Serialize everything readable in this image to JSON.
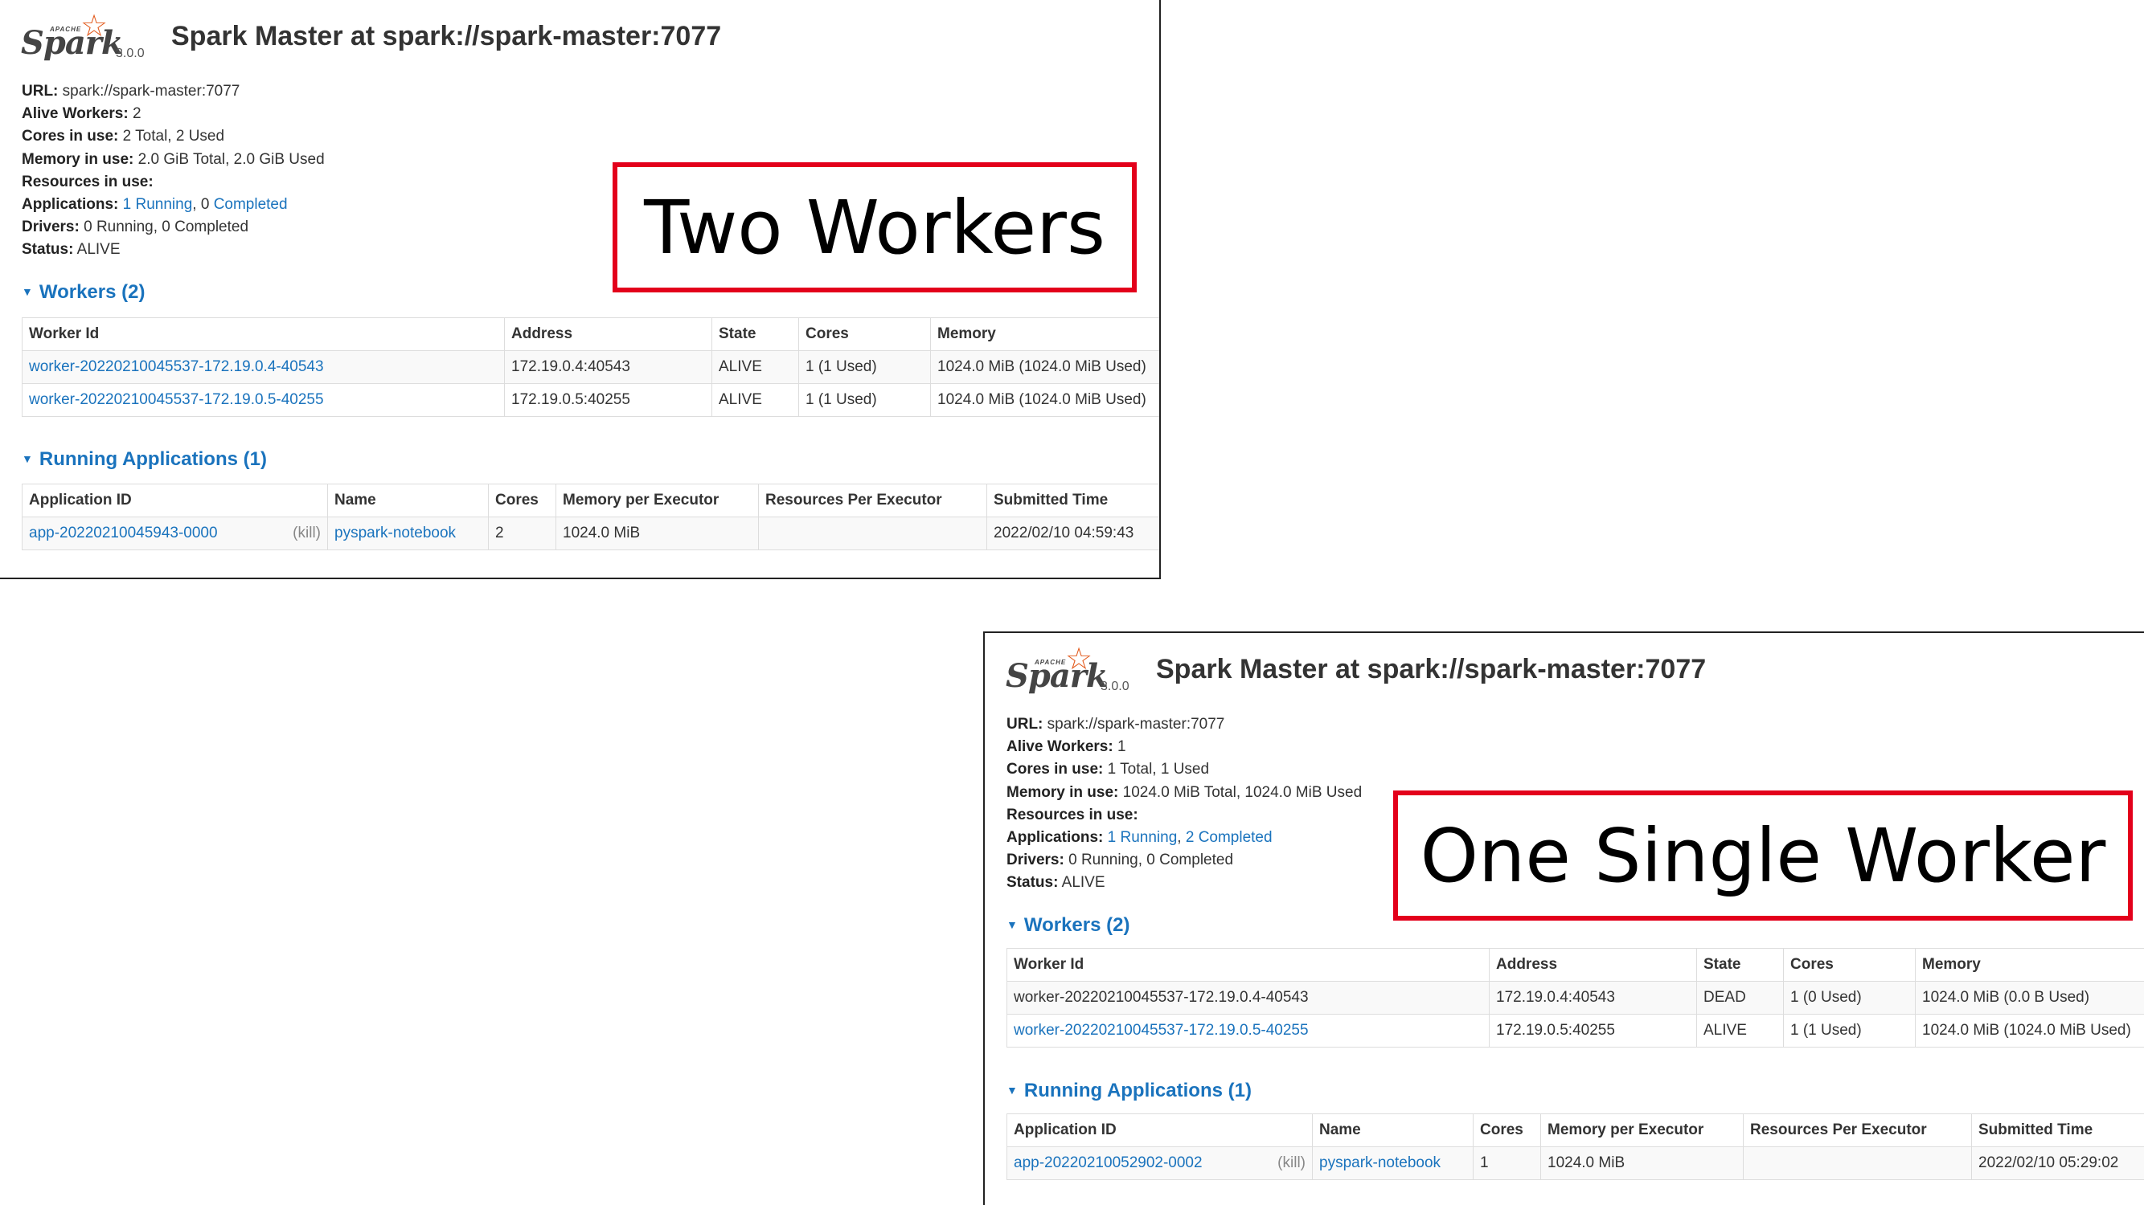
{
  "panel_top": {
    "logo": {
      "apache": "APACHE",
      "word": "Spark",
      "version": "3.0.0"
    },
    "title": "Spark Master at spark://spark-master:7077",
    "summary": {
      "url_label": "URL:",
      "url_value": "spark://spark-master:7077",
      "alive_label": "Alive Workers:",
      "alive_value": "2",
      "cores_label": "Cores in use:",
      "cores_value": "2 Total, 2 Used",
      "memory_label": "Memory in use:",
      "memory_value": "2.0 GiB Total, 2.0 GiB Used",
      "resources_label": "Resources in use:",
      "apps_label": "Applications:",
      "apps_running_count": "1",
      "apps_running_link": "Running",
      "apps_sep": ",",
      "apps_completed_count": "0",
      "apps_completed_link": "Completed",
      "drivers_label": "Drivers:",
      "drivers_value": "0 Running, 0 Completed",
      "status_label": "Status:",
      "status_value": "ALIVE"
    },
    "workers_section": "Workers (2)",
    "workers_headers": [
      "Worker Id",
      "Address",
      "State",
      "Cores",
      "Memory"
    ],
    "workers": [
      {
        "id": "worker-20220210045537-172.19.0.4-40543",
        "address": "172.19.0.4:40543",
        "state": "ALIVE",
        "cores": "1 (1 Used)",
        "memory": "1024.0 MiB (1024.0 MiB Used)"
      },
      {
        "id": "worker-20220210045537-172.19.0.5-40255",
        "address": "172.19.0.5:40255",
        "state": "ALIVE",
        "cores": "1 (1 Used)",
        "memory": "1024.0 MiB (1024.0 MiB Used)"
      }
    ],
    "apps_section": "Running Applications (1)",
    "apps_headers": [
      "Application ID",
      "Name",
      "Cores",
      "Memory per Executor",
      "Resources Per Executor",
      "Submitted Time"
    ],
    "apps": [
      {
        "id": "app-20220210045943-0000",
        "kill": "(kill)",
        "name": "pyspark-notebook",
        "cores": "2",
        "memory": "1024.0 MiB",
        "resources": "",
        "submitted": "2022/02/10 04:59:43"
      }
    ],
    "callout": "Two Workers"
  },
  "panel_bottom": {
    "logo": {
      "apache": "APACHE",
      "word": "Spark",
      "version": "3.0.0"
    },
    "title": "Spark Master at spark://spark-master:7077",
    "summary": {
      "url_label": "URL:",
      "url_value": "spark://spark-master:7077",
      "alive_label": "Alive Workers:",
      "alive_value": "1",
      "cores_label": "Cores in use:",
      "cores_value": "1 Total, 1 Used",
      "memory_label": "Memory in use:",
      "memory_value": "1024.0 MiB Total, 1024.0 MiB Used",
      "resources_label": "Resources in use:",
      "apps_label": "Applications:",
      "apps_running_count": "1",
      "apps_running_link": "Running",
      "apps_sep": ",",
      "apps_completed_count": "2",
      "apps_completed_link": "Completed",
      "drivers_label": "Drivers:",
      "drivers_value": "0 Running, 0 Completed",
      "status_label": "Status:",
      "status_value": "ALIVE"
    },
    "workers_section": "Workers (2)",
    "workers_headers": [
      "Worker Id",
      "Address",
      "State",
      "Cores",
      "Memory"
    ],
    "workers": [
      {
        "id": "worker-20220210045537-172.19.0.4-40543",
        "address": "172.19.0.4:40543",
        "state": "DEAD",
        "cores": "1 (0 Used)",
        "memory": "1024.0 MiB (0.0 B Used)"
      },
      {
        "id": "worker-20220210045537-172.19.0.5-40255",
        "address": "172.19.0.5:40255",
        "state": "ALIVE",
        "cores": "1 (1 Used)",
        "memory": "1024.0 MiB (1024.0 MiB Used)"
      }
    ],
    "apps_section": "Running Applications (1)",
    "apps_headers": [
      "Application ID",
      "Name",
      "Cores",
      "Memory per Executor",
      "Resources Per Executor",
      "Submitted Time"
    ],
    "apps": [
      {
        "id": "app-20220210052902-0002",
        "kill": "(kill)",
        "name": "pyspark-notebook",
        "cores": "1",
        "memory": "1024.0 MiB",
        "resources": "",
        "submitted": "2022/02/10 05:29:02"
      }
    ],
    "callout": "One Single Worker"
  },
  "colors": {
    "link": "#1a73bd",
    "callout_border": "#e3001b",
    "spark_orange": "#e25a1c"
  },
  "icons": {
    "section_toggle": "caret-down-icon",
    "logo_star": "spark-star-icon"
  }
}
